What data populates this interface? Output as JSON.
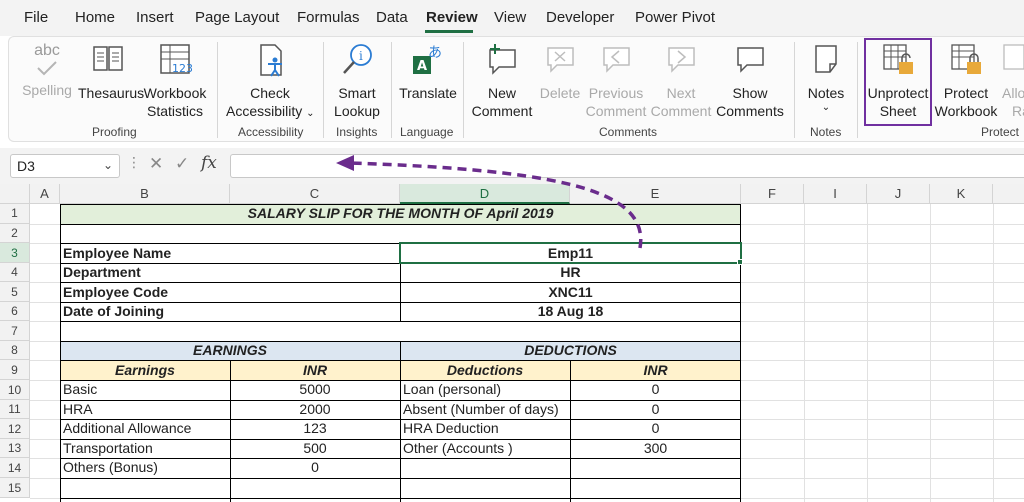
{
  "menu": [
    "File",
    "Home",
    "Insert",
    "Page Layout",
    "Formulas",
    "Data",
    "Review",
    "View",
    "Developer",
    "Power Pivot"
  ],
  "ribbon": {
    "spelling": {
      "icon_text": "abc",
      "label": "Spelling"
    },
    "thesaurus": "Thesaurus",
    "workbook_statistics": [
      "Workbook",
      "Statistics"
    ],
    "check_accessibility": [
      "Check",
      "Accessibility"
    ],
    "smart_lookup": [
      "Smart",
      "Lookup"
    ],
    "translate": "Translate",
    "new_comment": [
      "New",
      "Comment"
    ],
    "delete": "Delete",
    "previous_comment": [
      "Previous",
      "Comment"
    ],
    "next_comment": [
      "Next",
      "Comment"
    ],
    "show_comments": [
      "Show",
      "Comments"
    ],
    "notes": "Notes",
    "unprotect_sheet": [
      "Unprotect",
      "Sheet"
    ],
    "protect_workbook": [
      "Protect",
      "Workbook"
    ],
    "allow_ranges": [
      "Allo",
      "Ra"
    ],
    "groups": [
      "Proofing",
      "Accessibility",
      "Insights",
      "Language",
      "Comments",
      "Notes",
      "Protect"
    ]
  },
  "formula_bar": {
    "name_box": "D3",
    "fx": "fx",
    "value": ""
  },
  "columns": [
    "A",
    "B",
    "C",
    "D",
    "E",
    "F",
    "I",
    "J",
    "K"
  ],
  "rows": [
    "1",
    "2",
    "3",
    "4",
    "5",
    "6",
    "7",
    "8",
    "9",
    "10",
    "11",
    "12",
    "13",
    "14",
    "15"
  ],
  "sheet": {
    "title": "SALARY SLIP FOR THE MONTH OF April 2019",
    "info": [
      {
        "label": "Employee Name",
        "value": "Emp11"
      },
      {
        "label": "Department",
        "value": "HR"
      },
      {
        "label": "Employee Code",
        "value": "XNC11"
      },
      {
        "label": "Date of Joining",
        "value": "18 Aug 18"
      }
    ],
    "earnings_header": "EARNINGS",
    "deductions_header": "DEDUCTIONS",
    "earnings_col": "Earnings",
    "deductions_col": "Deductions",
    "inr": "INR",
    "earnings": [
      {
        "name": "Basic",
        "inr": "5000"
      },
      {
        "name": "HRA",
        "inr": "2000"
      },
      {
        "name": "Additional Allowance",
        "inr": "123"
      },
      {
        "name": "Transportation",
        "inr": "500"
      },
      {
        "name": "Others (Bonus)",
        "inr": "0"
      }
    ],
    "deductions": [
      {
        "name": "Loan (personal)",
        "inr": "0"
      },
      {
        "name": "Absent (Number of days)",
        "inr": "0"
      },
      {
        "name": "HRA Deduction",
        "inr": "0"
      },
      {
        "name": "Other (Accounts )",
        "inr": "300"
      }
    ]
  },
  "colors": {
    "title_fill": "#e2efda",
    "section_fill": "#dce6f1",
    "header_fill": "#fff2cc",
    "annotation": "#7030a0",
    "accent": "#1f6f43"
  }
}
